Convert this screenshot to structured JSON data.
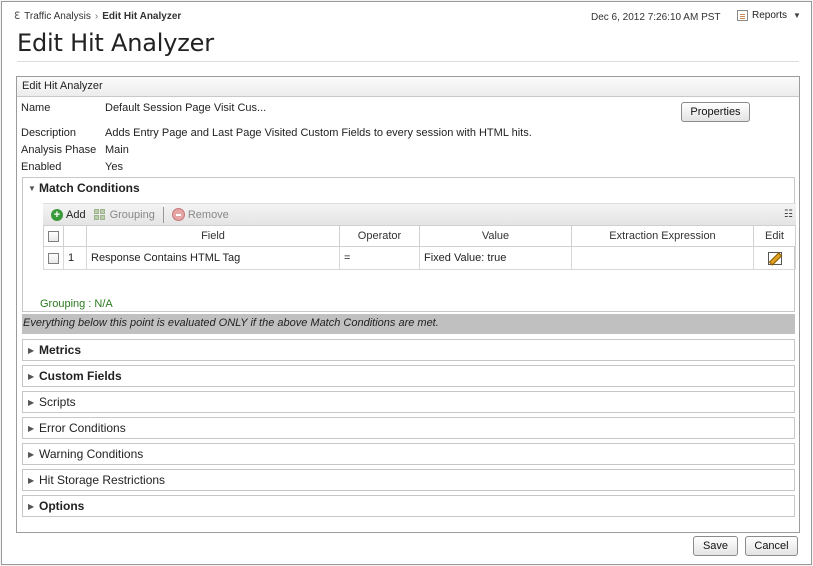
{
  "breadcrumb": {
    "parent": "Traffic Analysis",
    "current": "Edit Hit Analyzer"
  },
  "header": {
    "datetime": "Dec 6, 2012 7:26:10 AM PST",
    "reports_label": "Reports"
  },
  "page_title": "Edit Hit Analyzer",
  "panel": {
    "title": "Edit Hit Analyzer",
    "properties_button": "Properties",
    "fields": {
      "name_label": "Name",
      "name_value": "Default Session Page Visit Cus...",
      "description_label": "Description",
      "description_value": "Adds Entry Page and Last Page Visited Custom Fields to every session with HTML hits.",
      "phase_label": "Analysis Phase",
      "phase_value": "Main",
      "enabled_label": "Enabled",
      "enabled_value": "Yes"
    }
  },
  "match_conditions": {
    "title": "Match Conditions",
    "toolbar": {
      "add": "Add",
      "grouping": "Grouping",
      "remove": "Remove"
    },
    "columns": {
      "field": "Field",
      "operator": "Operator",
      "value": "Value",
      "extraction": "Extraction Expression",
      "edit": "Edit"
    },
    "rows": [
      {
        "index": "1",
        "field": "Response Contains HTML Tag",
        "operator": "=",
        "value": "Fixed Value: true",
        "extraction": ""
      }
    ],
    "grouping_text": "Grouping : N/A"
  },
  "notice": "Everything below this point is evaluated ONLY if the above Match Conditions are met.",
  "sections": {
    "metrics": "Metrics",
    "custom_fields": "Custom Fields",
    "scripts": "Scripts",
    "error_conditions": "Error Conditions",
    "warning_conditions": "Warning Conditions",
    "hit_storage": "Hit Storage Restrictions",
    "options": "Options"
  },
  "footer": {
    "save": "Save",
    "cancel": "Cancel"
  }
}
